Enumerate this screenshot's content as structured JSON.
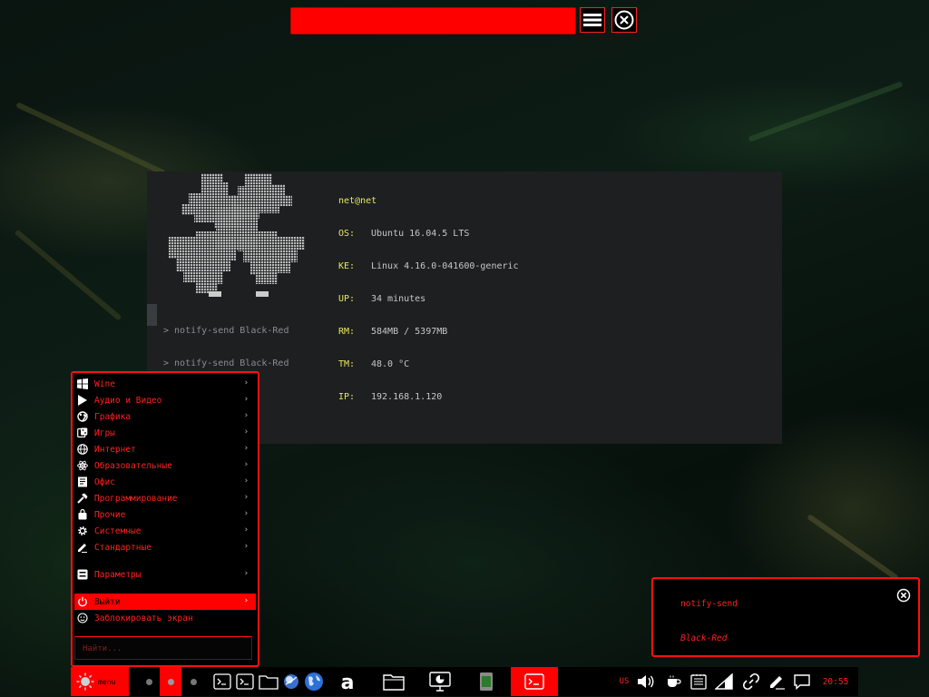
{
  "terminal": {
    "hostline": "net@net",
    "sysinfo": [
      {
        "key": "OS:",
        "value": "Ubuntu 16.04.5 LTS"
      },
      {
        "key": "KE:",
        "value": "Linux 4.16.0-041600-generic"
      },
      {
        "key": "UP:",
        "value": "34 minutes"
      },
      {
        "key": "RM:",
        "value": "584MB / 5397MB"
      },
      {
        "key": "TM:",
        "value": "48.0 °C"
      },
      {
        "key": "IP:",
        "value": "192.168.1.120"
      }
    ],
    "history": [
      "> notify-send Black-Red",
      "> notify-send Black-Red"
    ],
    "prompt": ">"
  },
  "menu": {
    "items": [
      {
        "label": "Wine",
        "icon": "windows-icon"
      },
      {
        "label": "Аудио и Видео",
        "icon": "play-icon"
      },
      {
        "label": "Графика",
        "icon": "palette-icon"
      },
      {
        "label": "Игры",
        "icon": "dice-icon"
      },
      {
        "label": "Интернет",
        "icon": "globe-icon"
      },
      {
        "label": "Образовательные",
        "icon": "atom-icon"
      },
      {
        "label": "Офис",
        "icon": "document-icon"
      },
      {
        "label": "Программирование",
        "icon": "hammer-icon"
      },
      {
        "label": "Прочие",
        "icon": "bag-icon"
      },
      {
        "label": "Системные",
        "icon": "gear-icon"
      },
      {
        "label": "Стандартные",
        "icon": "pen-icon"
      }
    ],
    "settings": {
      "label": "Параметры",
      "icon": "settings-panel-icon"
    },
    "logout": {
      "label": "Выйти",
      "icon": "power-icon"
    },
    "lock": {
      "label": "Заблокировать экран",
      "icon": "lock-face-icon"
    },
    "search_placeholder": "Найти..."
  },
  "notification": {
    "title": "notify-send",
    "body": "Black-Red"
  },
  "taskbar": {
    "menu_label": "menu",
    "keyboard_layout": "US",
    "clock": "20:55"
  },
  "colors": {
    "accent": "#ff0000",
    "terminal_bg": "#1d1f21",
    "terminal_key": "#e8e85a"
  }
}
